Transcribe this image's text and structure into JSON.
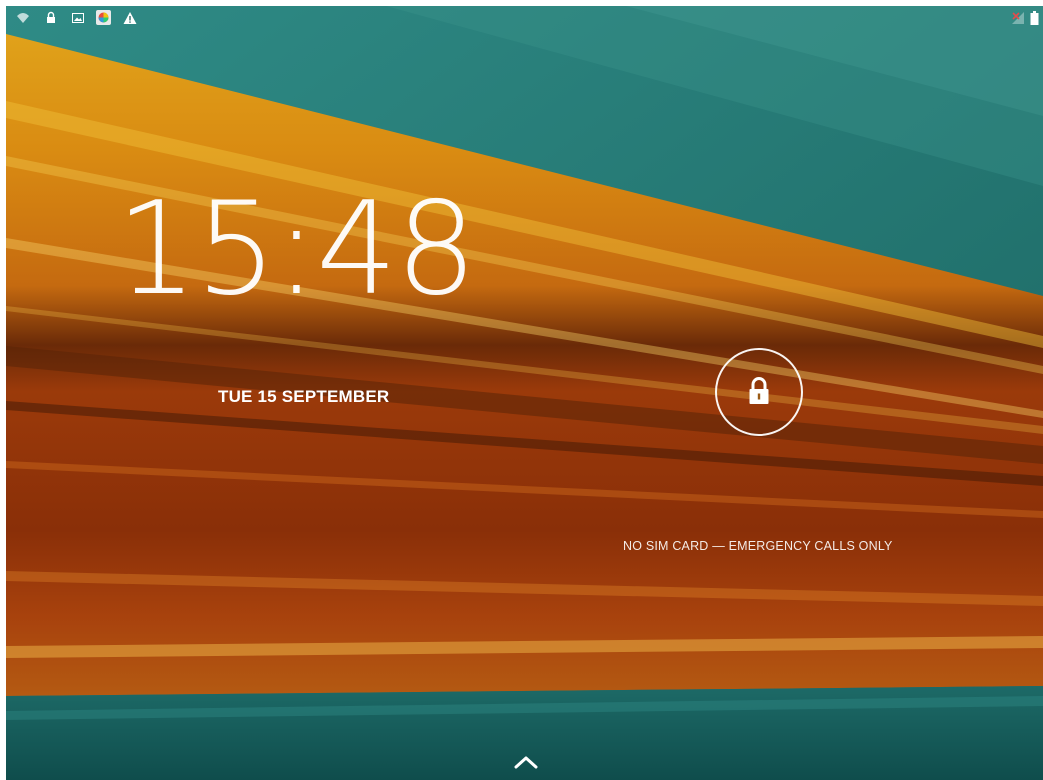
{
  "status_bar": {
    "left_icons": [
      "wifi-icon",
      "lock-icon",
      "picture-icon",
      "app-icon",
      "warning-icon"
    ],
    "right_icons": [
      "no-signal-icon",
      "battery-icon"
    ]
  },
  "lockscreen": {
    "time": "15:48",
    "date": "TUE 15 SEPTEMBER",
    "carrier_text": "NO SIM CARD — EMERGENCY CALLS ONLY",
    "unlock_icon": "padlock-icon",
    "swipe_up_icon": "chevron-up-icon"
  },
  "colors": {
    "teal": "#1f6f6c",
    "orange": "#e08a10",
    "dark_orange": "#8a2f08",
    "text": "#ffffff"
  }
}
